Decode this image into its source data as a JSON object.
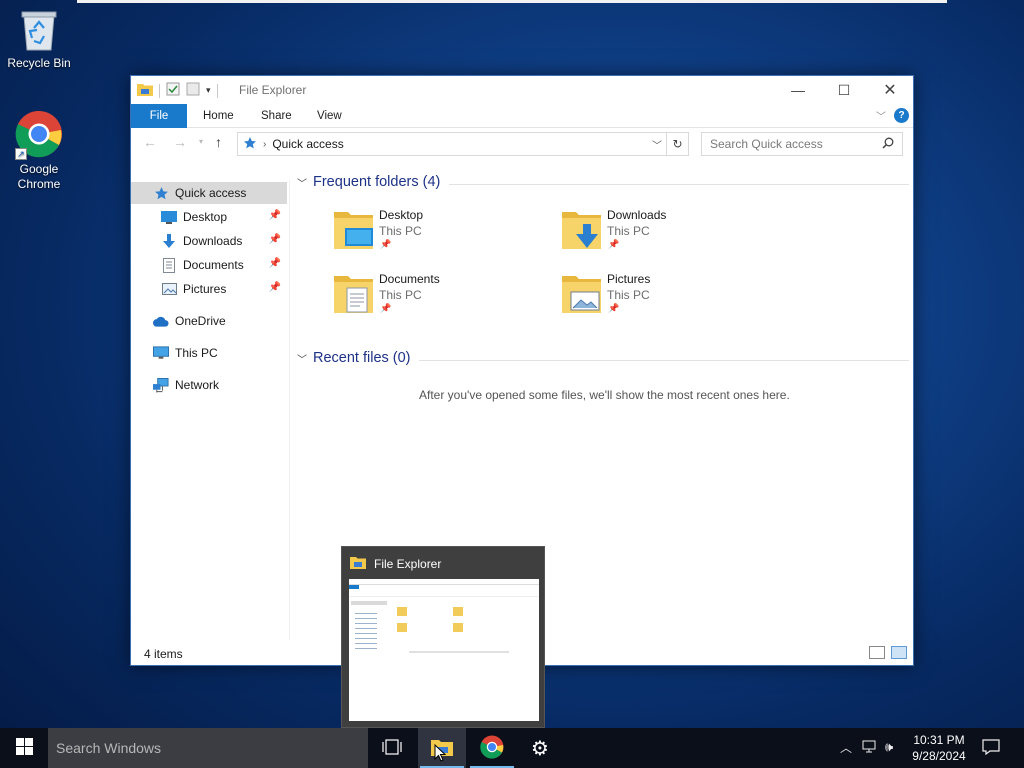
{
  "desktop": {
    "icons": [
      {
        "label": "Recycle Bin"
      },
      {
        "label": "Google\nChrome"
      }
    ]
  },
  "explorer": {
    "title": "File Explorer",
    "ribbon_tabs": [
      "File",
      "Home",
      "Share",
      "View"
    ],
    "address": "Quick access",
    "search_placeholder": "Search Quick access",
    "nav": {
      "quick_access": "Quick access",
      "pinned": [
        "Desktop",
        "Downloads",
        "Documents",
        "Pictures"
      ],
      "onedrive": "OneDrive",
      "this_pc": "This PC",
      "network": "Network"
    },
    "frequent_header": "Frequent folders (4)",
    "folders": [
      {
        "name": "Desktop",
        "location": "This PC"
      },
      {
        "name": "Downloads",
        "location": "This PC"
      },
      {
        "name": "Documents",
        "location": "This PC"
      },
      {
        "name": "Pictures",
        "location": "This PC"
      }
    ],
    "recent_header": "Recent files (0)",
    "recent_empty": "After you've opened some files, we'll show the most recent ones here.",
    "status": "4 items"
  },
  "thumbnail": {
    "title": "File Explorer"
  },
  "taskbar": {
    "search_placeholder": "Search Windows",
    "time": "10:31 PM",
    "date": "9/28/2024"
  }
}
